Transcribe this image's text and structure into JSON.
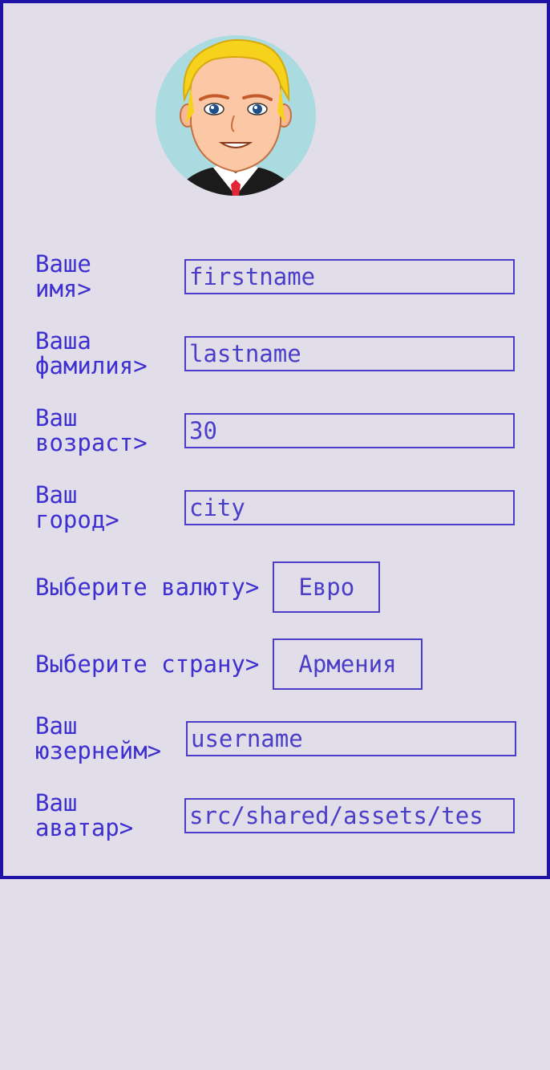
{
  "profile": {
    "avatar_alt": "avatar",
    "fields": {
      "firstname": {
        "label": "Ваше\nимя>",
        "value": "firstname"
      },
      "lastname": {
        "label": "Ваша\nфамилия>",
        "value": "lastname"
      },
      "age": {
        "label": "Ваш\nвозраст>",
        "value": "30"
      },
      "city": {
        "label": "Ваш\nгород>",
        "value": "city"
      },
      "currency": {
        "label": "Выберите валюту>",
        "value": "Евро"
      },
      "country": {
        "label": "Выберите страну>",
        "value": "Армения"
      },
      "username": {
        "label": "Ваш\nюзернейм>",
        "value": "username"
      },
      "avatar": {
        "label": "Ваш\nаватар>",
        "value": "src/shared/assets/tes"
      }
    }
  },
  "colors": {
    "background": "#e2dee9",
    "border": "#1f12a6",
    "text": "#3e2fd0",
    "input_border": "#4a3ec8"
  }
}
